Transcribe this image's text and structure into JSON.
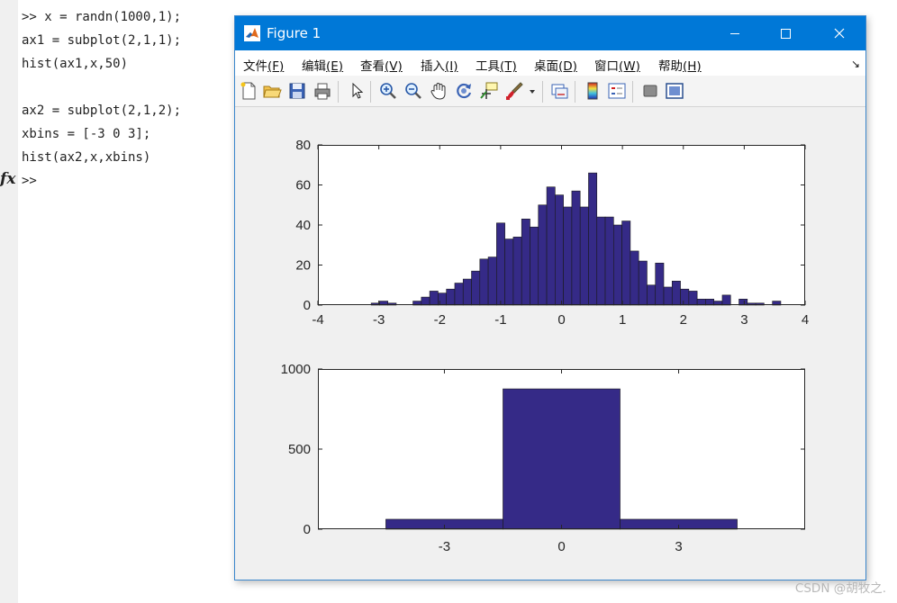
{
  "command_window": {
    "lines": [
      ">> x = randn(1000,1);",
      "ax1 = subplot(2,1,1);",
      "hist(ax1,x,50)",
      "",
      "ax2 = subplot(2,1,2);",
      "xbins = [-3 0 3];",
      "hist(ax2,x,xbins)",
      ">>"
    ],
    "fx_label": "fx"
  },
  "figure": {
    "title": "Figure 1",
    "menu": [
      {
        "label": "文件",
        "key": "(F)"
      },
      {
        "label": "编辑",
        "key": "(E)"
      },
      {
        "label": "查看",
        "key": "(V)"
      },
      {
        "label": "插入",
        "key": "(I)"
      },
      {
        "label": "工具",
        "key": "(T)"
      },
      {
        "label": "桌面",
        "key": "(D)"
      },
      {
        "label": "窗口",
        "key": "(W)"
      },
      {
        "label": "帮助",
        "key": "(H)"
      }
    ],
    "toolbar_icons": [
      "new-figure-icon",
      "open-file-icon",
      "save-icon",
      "print-icon",
      "pointer-icon",
      "zoom-in-icon",
      "zoom-out-icon",
      "pan-icon",
      "rotate-icon",
      "data-cursor-icon",
      "brush-icon",
      "link-plot-icon",
      "colorbar-icon",
      "legend-icon",
      "hide-plot-tools-icon",
      "show-plot-tools-icon"
    ]
  },
  "colors": {
    "bar_fill": "#352a87",
    "bar_edge": "#1a1a1a",
    "titlebar": "#0078d7"
  },
  "chart_data": [
    {
      "type": "bar",
      "title": "",
      "xlabel": "",
      "ylabel": "",
      "xlim": [
        -4,
        4
      ],
      "ylim": [
        0,
        80
      ],
      "xticks": [
        "-4",
        "-3",
        "-2",
        "-1",
        "0",
        "1",
        "2",
        "3",
        "4"
      ],
      "yticks": [
        "0",
        "20",
        "40",
        "60",
        "80"
      ],
      "bin_range": [
        -3.4,
        3.6
      ],
      "values": [
        0,
        0,
        1,
        2,
        1,
        0,
        0,
        2,
        4,
        7,
        6,
        8,
        11,
        13,
        17,
        23,
        24,
        41,
        33,
        34,
        43,
        39,
        50,
        59,
        55,
        49,
        57,
        49,
        66,
        44,
        44,
        40,
        42,
        27,
        22,
        10,
        21,
        9,
        12,
        8,
        7,
        3,
        3,
        2,
        5,
        0,
        3,
        1,
        1,
        0,
        2
      ]
    },
    {
      "type": "bar",
      "title": "",
      "xlabel": "",
      "ylabel": "",
      "ylim": [
        0,
        1000
      ],
      "xticks": [
        "-3",
        "0",
        "3"
      ],
      "yticks": [
        "0",
        "500",
        "1000"
      ],
      "categories": [
        "-3",
        "0",
        "3"
      ],
      "values": [
        62,
        876,
        62
      ]
    }
  ],
  "watermark": "CSDN @胡牧之."
}
